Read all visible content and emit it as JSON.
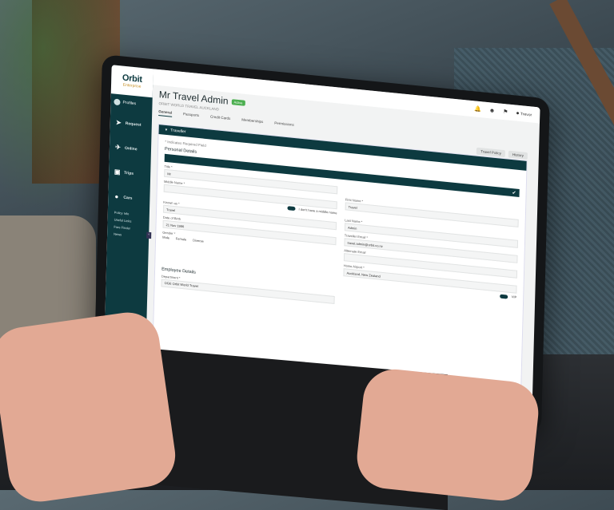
{
  "app": {
    "logo_main": "Orbit",
    "logo_sub": "Enterprise",
    "profile_label": "Profiles"
  },
  "sidebar": {
    "items": [
      {
        "label": "Request",
        "icon": "paper-plane-icon"
      },
      {
        "label": "Online",
        "icon": "airplane-icon"
      },
      {
        "label": "Trips",
        "icon": "suitcase-icon"
      },
      {
        "label": "Cars",
        "icon": "car-icon"
      }
    ],
    "links": [
      "Policy Info",
      "Useful Links",
      "Fare Finder",
      "News"
    ]
  },
  "topbar": {
    "user_label": "Trevor",
    "icons": [
      "bell-icon",
      "users-icon",
      "flag-icon",
      "user-icon"
    ]
  },
  "header": {
    "title": "Mr Travel Admin",
    "badge": "Active",
    "company": "ORBIT WORLD TRAVEL AUCKLAND"
  },
  "tabs": [
    "General",
    "Passports",
    "Credit Cards",
    "Memberships",
    "Permissions"
  ],
  "tools": [
    "Travel Policy",
    "History"
  ],
  "panel": {
    "title": "Traveller",
    "required_note": "* Indicates Required Field",
    "personal_section": "Personal Details",
    "employee_section": "Employee Details",
    "fields": {
      "title_label": "Title *",
      "title_value": "Mr",
      "middle_name_label": "Middle Name *",
      "no_middle_name": "I don't have a middle name",
      "first_name_label": "First Name *",
      "first_name_value": "Travel",
      "known_as_label": "Known as *",
      "known_as_value": "Travel",
      "last_name_label": "Last Name *",
      "last_name_value": "Admin",
      "dob_label": "Date of Birth",
      "dob_value": "21 Nov 1986",
      "email_label": "Traveller Email *",
      "email_value": "travel.admin@orbit.co.nz",
      "gender_label": "Gender *",
      "gender_options": [
        "Male",
        "Female",
        "Diverse"
      ],
      "alt_email_label": "Alternate Email",
      "home_airport_label": "Home Airport *",
      "home_airport_value": "Auckland, New Zealand",
      "vip_label": "VIP",
      "department_label": "Department *",
      "department_value": "OGE Orbit World Travel"
    }
  }
}
